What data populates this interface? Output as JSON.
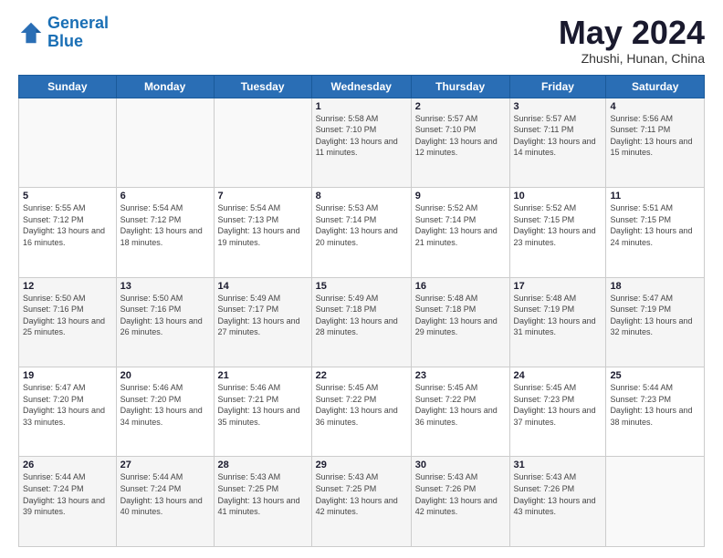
{
  "header": {
    "logo_line1": "General",
    "logo_line2": "Blue",
    "month": "May 2024",
    "location": "Zhushi, Hunan, China"
  },
  "days_of_week": [
    "Sunday",
    "Monday",
    "Tuesday",
    "Wednesday",
    "Thursday",
    "Friday",
    "Saturday"
  ],
  "weeks": [
    [
      {
        "day": "",
        "info": ""
      },
      {
        "day": "",
        "info": ""
      },
      {
        "day": "",
        "info": ""
      },
      {
        "day": "1",
        "info": "Sunrise: 5:58 AM\nSunset: 7:10 PM\nDaylight: 13 hours and 11 minutes."
      },
      {
        "day": "2",
        "info": "Sunrise: 5:57 AM\nSunset: 7:10 PM\nDaylight: 13 hours and 12 minutes."
      },
      {
        "day": "3",
        "info": "Sunrise: 5:57 AM\nSunset: 7:11 PM\nDaylight: 13 hours and 14 minutes."
      },
      {
        "day": "4",
        "info": "Sunrise: 5:56 AM\nSunset: 7:11 PM\nDaylight: 13 hours and 15 minutes."
      }
    ],
    [
      {
        "day": "5",
        "info": "Sunrise: 5:55 AM\nSunset: 7:12 PM\nDaylight: 13 hours and 16 minutes."
      },
      {
        "day": "6",
        "info": "Sunrise: 5:54 AM\nSunset: 7:12 PM\nDaylight: 13 hours and 18 minutes."
      },
      {
        "day": "7",
        "info": "Sunrise: 5:54 AM\nSunset: 7:13 PM\nDaylight: 13 hours and 19 minutes."
      },
      {
        "day": "8",
        "info": "Sunrise: 5:53 AM\nSunset: 7:14 PM\nDaylight: 13 hours and 20 minutes."
      },
      {
        "day": "9",
        "info": "Sunrise: 5:52 AM\nSunset: 7:14 PM\nDaylight: 13 hours and 21 minutes."
      },
      {
        "day": "10",
        "info": "Sunrise: 5:52 AM\nSunset: 7:15 PM\nDaylight: 13 hours and 23 minutes."
      },
      {
        "day": "11",
        "info": "Sunrise: 5:51 AM\nSunset: 7:15 PM\nDaylight: 13 hours and 24 minutes."
      }
    ],
    [
      {
        "day": "12",
        "info": "Sunrise: 5:50 AM\nSunset: 7:16 PM\nDaylight: 13 hours and 25 minutes."
      },
      {
        "day": "13",
        "info": "Sunrise: 5:50 AM\nSunset: 7:16 PM\nDaylight: 13 hours and 26 minutes."
      },
      {
        "day": "14",
        "info": "Sunrise: 5:49 AM\nSunset: 7:17 PM\nDaylight: 13 hours and 27 minutes."
      },
      {
        "day": "15",
        "info": "Sunrise: 5:49 AM\nSunset: 7:18 PM\nDaylight: 13 hours and 28 minutes."
      },
      {
        "day": "16",
        "info": "Sunrise: 5:48 AM\nSunset: 7:18 PM\nDaylight: 13 hours and 29 minutes."
      },
      {
        "day": "17",
        "info": "Sunrise: 5:48 AM\nSunset: 7:19 PM\nDaylight: 13 hours and 31 minutes."
      },
      {
        "day": "18",
        "info": "Sunrise: 5:47 AM\nSunset: 7:19 PM\nDaylight: 13 hours and 32 minutes."
      }
    ],
    [
      {
        "day": "19",
        "info": "Sunrise: 5:47 AM\nSunset: 7:20 PM\nDaylight: 13 hours and 33 minutes."
      },
      {
        "day": "20",
        "info": "Sunrise: 5:46 AM\nSunset: 7:20 PM\nDaylight: 13 hours and 34 minutes."
      },
      {
        "day": "21",
        "info": "Sunrise: 5:46 AM\nSunset: 7:21 PM\nDaylight: 13 hours and 35 minutes."
      },
      {
        "day": "22",
        "info": "Sunrise: 5:45 AM\nSunset: 7:22 PM\nDaylight: 13 hours and 36 minutes."
      },
      {
        "day": "23",
        "info": "Sunrise: 5:45 AM\nSunset: 7:22 PM\nDaylight: 13 hours and 36 minutes."
      },
      {
        "day": "24",
        "info": "Sunrise: 5:45 AM\nSunset: 7:23 PM\nDaylight: 13 hours and 37 minutes."
      },
      {
        "day": "25",
        "info": "Sunrise: 5:44 AM\nSunset: 7:23 PM\nDaylight: 13 hours and 38 minutes."
      }
    ],
    [
      {
        "day": "26",
        "info": "Sunrise: 5:44 AM\nSunset: 7:24 PM\nDaylight: 13 hours and 39 minutes."
      },
      {
        "day": "27",
        "info": "Sunrise: 5:44 AM\nSunset: 7:24 PM\nDaylight: 13 hours and 40 minutes."
      },
      {
        "day": "28",
        "info": "Sunrise: 5:43 AM\nSunset: 7:25 PM\nDaylight: 13 hours and 41 minutes."
      },
      {
        "day": "29",
        "info": "Sunrise: 5:43 AM\nSunset: 7:25 PM\nDaylight: 13 hours and 42 minutes."
      },
      {
        "day": "30",
        "info": "Sunrise: 5:43 AM\nSunset: 7:26 PM\nDaylight: 13 hours and 42 minutes."
      },
      {
        "day": "31",
        "info": "Sunrise: 5:43 AM\nSunset: 7:26 PM\nDaylight: 13 hours and 43 minutes."
      },
      {
        "day": "",
        "info": ""
      }
    ]
  ]
}
